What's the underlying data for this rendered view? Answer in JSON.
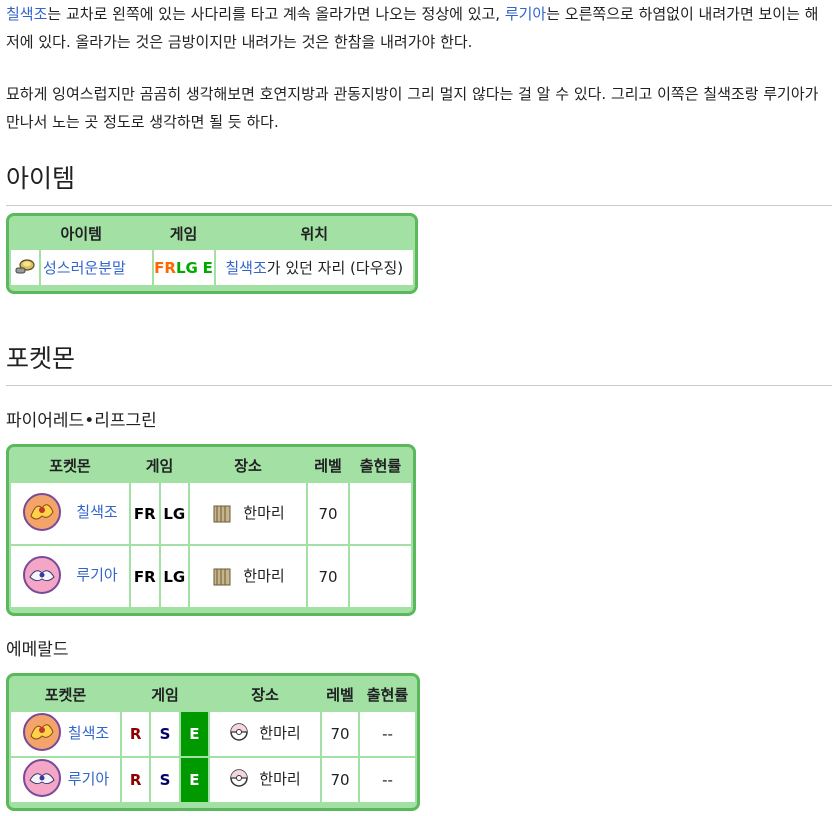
{
  "intro": {
    "p1": {
      "link1": "칠색조",
      "text1": "는 교차로 왼쪽에 있는 사다리를 타고 계속 올라가면 나오는 정상에 있고, ",
      "link2": "루기아",
      "text2": "는 오른쪽으로 하염없이 내려가면 보이는 해저에 있다. 올라가는 것은 금방이지만 내려가는 것은 한참을 내려가야 한다."
    },
    "p2": "묘하게 잉여스럽지만 곰곰히 생각해보면 호연지방과 관동지방이 그리 멀지 않다는 걸 알 수 있다. 그리고 이쪽은 칠색조랑 루기아가 만나서 노는 곳 정도로 생각하면 될 듯 하다."
  },
  "items_section": {
    "heading": "아이템",
    "headers": [
      "아이템",
      "게임",
      "위치"
    ],
    "row": {
      "icon": "mystic-item-icon",
      "item": "성스러운분말",
      "game_fr": "FR",
      "game_lg": "LG",
      "game_e": "E",
      "location_link": "칠색조",
      "location_text": "가 있던 자리 (다우징)"
    }
  },
  "pokemon_section": {
    "heading": "포켓몬",
    "frlg": {
      "subheading": "파이어레드•리프그린",
      "headers": [
        "포켓몬",
        "게임",
        "장소",
        "레벨",
        "출현률"
      ],
      "rows": [
        {
          "name": "칠색조",
          "icon": "ho-oh-icon",
          "v1": "FR",
          "v2": "LG",
          "method_icon": "old-rod-icon",
          "method": "한마리",
          "level": "70",
          "rate": ""
        },
        {
          "name": "루기아",
          "icon": "lugia-icon",
          "v1": "FR",
          "v2": "LG",
          "method_icon": "old-rod-icon",
          "method": "한마리",
          "level": "70",
          "rate": ""
        }
      ]
    },
    "emerald": {
      "subheading": "에메랄드",
      "headers": [
        "포켓몬",
        "게임",
        "장소",
        "레벨",
        "출현률"
      ],
      "rows": [
        {
          "name": "칠색조",
          "icon": "ho-oh-icon",
          "v1": "R",
          "v2": "S",
          "v3": "E",
          "method_icon": "pokeball-icon",
          "method": "한마리",
          "level": "70",
          "rate": "--"
        },
        {
          "name": "루기아",
          "icon": "lugia-icon",
          "v1": "R",
          "v2": "S",
          "v3": "E",
          "method_icon": "pokeball-icon",
          "method": "한마리",
          "level": "70",
          "rate": "--"
        }
      ]
    }
  },
  "colors": {
    "link": "#3366cc",
    "table_border": "#5cb85c",
    "table_header": "#a3e0a3",
    "fr": "#ff7a1e",
    "lg": "#00dd00",
    "e": "#009a00"
  }
}
